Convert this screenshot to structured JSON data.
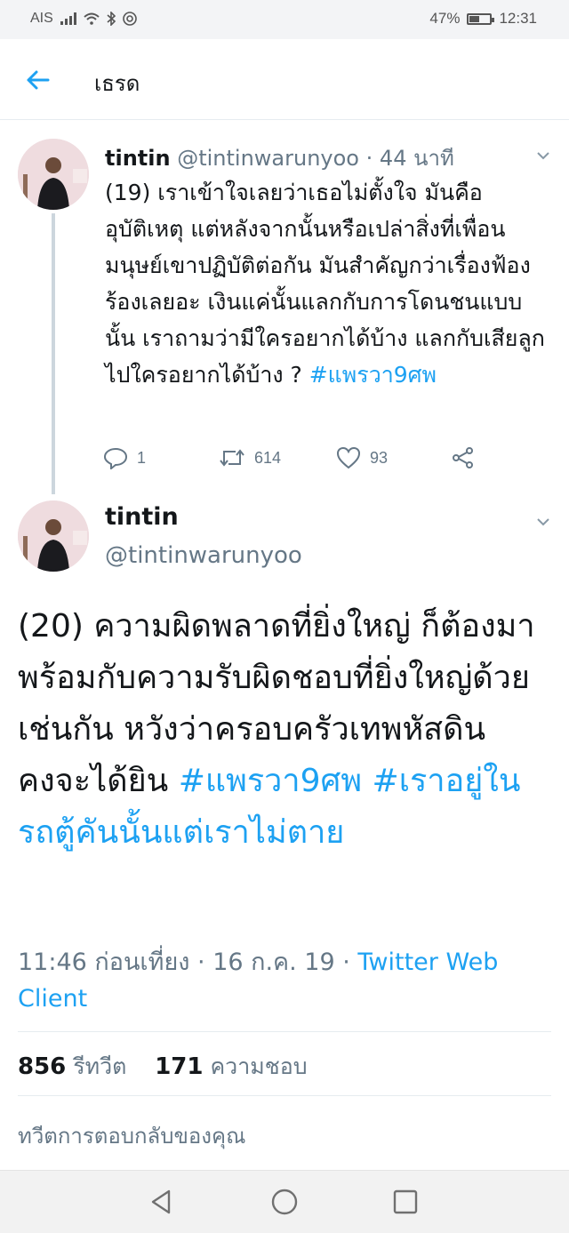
{
  "status_bar": {
    "carrier": "AIS",
    "battery_percent": "47%",
    "time": "12:31"
  },
  "header": {
    "title": "เธรด"
  },
  "tweet1": {
    "name": "tintin",
    "handle": "@tintinwarunyoo",
    "time_ago": "44 นาที",
    "text": "(19) เราเข้าใจเลยว่าเธอไม่ตั้งใจ มันคืออุบัติเหตุ แต่หลังจากนั้นหรือเปล่าสิ่งที่เพื่อนมนุษย์เขาปฏิบัติต่อกัน มันสำคัญกว่าเรื่องฟ้องร้องเลยอะ เงินแค่นั้นแลกกับการโดนชนแบบนั้น เราถามว่ามีใครอยากได้บ้าง แลกกับเสียลูกไปใครอยากได้บ้าง ?",
    "hashtag": "#แพรวา9ศพ",
    "replies": "1",
    "retweets": "614",
    "likes": "93"
  },
  "tweet2": {
    "name": "tintin",
    "handle": "@tintinwarunyoo",
    "text": "(20) ความผิดพลาดที่ยิ่งใหญ่ ก็ต้องมาพร้อมกับความรับผิดชอบที่ยิ่งใหญ่ด้วยเช่นกัน หวังว่าครอบครัวเทพหัสดิน คงจะได้ยิน",
    "hashtag1": "#แพรวา9ศพ",
    "hashtag2": "#เราอยู่ในรถตู้คันนั้นแต่เราไม่ตาย",
    "timestamp": "11:46 ก่อนเที่ยง · 16 ก.ค. 19 · ",
    "source": "Twitter Web Client",
    "retweet_count": "856",
    "retweet_label": "รีทวีต",
    "like_count": "171",
    "like_label": "ความชอบ"
  },
  "reply_placeholder": "ทวีตการตอบกลับของคุณ",
  "colors": {
    "accent": "#1da1f2",
    "secondary_text": "#657786"
  }
}
